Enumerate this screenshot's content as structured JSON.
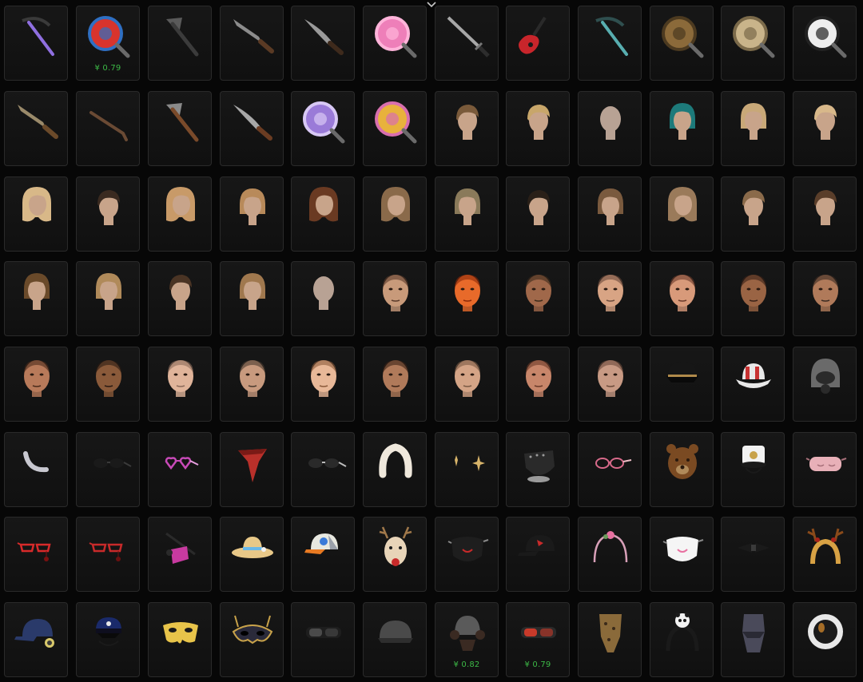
{
  "items": [
    {
      "icon": "purple-sickle-icon",
      "kind": "sickle",
      "c1": "#8f6fe0",
      "c2": "#3a3a3a",
      "price": ""
    },
    {
      "icon": "target-pan-icon",
      "kind": "pan",
      "c1": "#d8342d",
      "c2": "#2f6fc2",
      "price": "¥ 0.79"
    },
    {
      "icon": "hatchet-icon",
      "kind": "axe",
      "c1": "#5a5a5a",
      "c2": "#3b3b3b",
      "price": ""
    },
    {
      "icon": "cleaver-machete-icon",
      "kind": "machete",
      "c1": "#8c8c8c",
      "c2": "#5a3a24",
      "price": ""
    },
    {
      "icon": "kukri-knife-icon",
      "kind": "blade",
      "c1": "#9a9a9a",
      "c2": "#3e2a1c",
      "price": ""
    },
    {
      "icon": "pink-floral-pan-icon",
      "kind": "pan",
      "c1": "#ee7fb9",
      "c2": "#ffb4da",
      "price": ""
    },
    {
      "icon": "katana-icon",
      "kind": "sword",
      "c1": "#a7a7a7",
      "c2": "#2d2d2d",
      "price": ""
    },
    {
      "icon": "electric-guitar-icon",
      "kind": "guitar",
      "c1": "#c8252b",
      "c2": "#1a1a1a",
      "price": ""
    },
    {
      "icon": "teal-sickle-icon",
      "kind": "sickle",
      "c1": "#58aeb0",
      "c2": "#2f4f4f",
      "price": ""
    },
    {
      "icon": "ornate-gold-pan-icon",
      "kind": "pan",
      "c1": "#8b6a3a",
      "c2": "#4c3a20",
      "price": ""
    },
    {
      "icon": "silver-engraved-pan-icon",
      "kind": "pan",
      "c1": "#c9b48a",
      "c2": "#7b6a4a",
      "price": ""
    },
    {
      "icon": "black-white-pan-icon",
      "kind": "pan",
      "c1": "#eeeeee",
      "c2": "#222222",
      "price": ""
    },
    {
      "icon": "machete-icon",
      "kind": "machete",
      "c1": "#9a8a6a",
      "c2": "#6b4a2a",
      "price": ""
    },
    {
      "icon": "crowbar-icon",
      "kind": "crowbar",
      "c1": "#6a4a34",
      "c2": "#3a2a20",
      "price": ""
    },
    {
      "icon": "wood-axe-icon",
      "kind": "axe",
      "c1": "#8a8a8a",
      "c2": "#7a4a2a",
      "price": ""
    },
    {
      "icon": "curved-machete-icon",
      "kind": "blade",
      "c1": "#a8a8a8",
      "c2": "#6b3c22",
      "price": ""
    },
    {
      "icon": "purple-pan-icon",
      "kind": "pan",
      "c1": "#9a7ad8",
      "c2": "#d8c8f5",
      "price": ""
    },
    {
      "icon": "candy-swirl-pan-icon",
      "kind": "pan",
      "c1": "#e8b23c",
      "c2": "#d86fae",
      "price": ""
    },
    {
      "icon": "hair-short-brown-icon",
      "kind": "hairmale",
      "c1": "#7a5a3a",
      "c2": "#c8a48a",
      "price": ""
    },
    {
      "icon": "hair-short-blonde-icon",
      "kind": "hairmale",
      "c1": "#c8a66a",
      "c2": "#c8a48a",
      "price": ""
    },
    {
      "icon": "hair-shaved-icon",
      "kind": "head",
      "c1": "#b8a294",
      "c2": "#b8a294",
      "price": ""
    },
    {
      "icon": "hair-teal-bob-icon",
      "kind": "hairbob",
      "c1": "#1d7a7a",
      "c2": "#c8a48a",
      "price": ""
    },
    {
      "icon": "hair-blonde-bob-icon",
      "kind": "hairbob",
      "c1": "#c8a878",
      "c2": "#c8a48a",
      "price": ""
    },
    {
      "icon": "hair-blonde-short-icon",
      "kind": "hairmale",
      "c1": "#d8b88a",
      "c2": "#c8a48a",
      "price": ""
    },
    {
      "icon": "hair-blonde-long-icon",
      "kind": "hairlong",
      "c1": "#d8b888",
      "c2": "#c8a48a",
      "price": ""
    },
    {
      "icon": "hair-dark-undercut-icon",
      "kind": "hairmale",
      "c1": "#3a2a20",
      "c2": "#c8a48a",
      "price": ""
    },
    {
      "icon": "hair-blonde-shoulder-icon",
      "kind": "hairlong",
      "c1": "#c89a68",
      "c2": "#c8a48a",
      "price": ""
    },
    {
      "icon": "hair-braided-bun-icon",
      "kind": "hairbob",
      "c1": "#b88a5a",
      "c2": "#c8a48a",
      "price": ""
    },
    {
      "icon": "hair-brown-braids-icon",
      "kind": "hairlong",
      "c1": "#6a3a22",
      "c2": "#c8a48a",
      "price": ""
    },
    {
      "icon": "hair-wavy-brown-icon",
      "kind": "hairlong",
      "c1": "#8a6a4a",
      "c2": "#c8a48a",
      "price": ""
    },
    {
      "icon": "hair-bob-ash-icon",
      "kind": "hairbob",
      "c1": "#8a7a5a",
      "c2": "#c8a48a",
      "price": ""
    },
    {
      "icon": "hair-fade-dark-icon",
      "kind": "hairmale",
      "c1": "#2a2018",
      "c2": "#c8a48a",
      "price": ""
    },
    {
      "icon": "hair-messy-brown-icon",
      "kind": "hairbob",
      "c1": "#7a5a3e",
      "c2": "#c8a48a",
      "price": ""
    },
    {
      "icon": "hair-braided-light-icon",
      "kind": "hairlong",
      "c1": "#9a7a5a",
      "c2": "#c8a48a",
      "price": ""
    },
    {
      "icon": "hair-side-cut-icon",
      "kind": "hairmale",
      "c1": "#8a6a4a",
      "c2": "#c8a48a",
      "price": ""
    },
    {
      "icon": "hair-cornrow-icon",
      "kind": "hairmale",
      "c1": "#5a3e2a",
      "c2": "#c8a48a",
      "price": ""
    },
    {
      "icon": "hair-brown-fringe-icon",
      "kind": "hairbob",
      "c1": "#6a4a2a",
      "c2": "#c8a48a",
      "price": ""
    },
    {
      "icon": "hair-light-bob-icon",
      "kind": "hairbob",
      "c1": "#b08a5a",
      "c2": "#c8a48a",
      "price": ""
    },
    {
      "icon": "hair-quiff-icon",
      "kind": "hairmale",
      "c1": "#4a3424",
      "c2": "#c8a48a",
      "price": ""
    },
    {
      "icon": "hair-swept-bob-icon",
      "kind": "hairbob",
      "c1": "#a0784e",
      "c2": "#c8a48a",
      "price": ""
    },
    {
      "icon": "face-bald-profile-icon",
      "kind": "head",
      "c1": "#b8a294",
      "c2": "#b8a294",
      "price": ""
    },
    {
      "icon": "face-male-1-icon",
      "kind": "face",
      "c1": "#c89a7a",
      "c2": "#5a3a2a",
      "price": ""
    },
    {
      "icon": "face-male-orange-icon",
      "kind": "face",
      "c1": "#e86a2a",
      "c2": "#8a2a0a",
      "price": ""
    },
    {
      "icon": "face-male-2-icon",
      "kind": "face",
      "c1": "#a0684a",
      "c2": "#3a2a1a",
      "price": ""
    },
    {
      "icon": "face-male-3-icon",
      "kind": "face",
      "c1": "#d8a484",
      "c2": "#6a4a3a",
      "price": ""
    },
    {
      "icon": "face-male-4-icon",
      "kind": "face",
      "c1": "#d89a7a",
      "c2": "#6a3a2a",
      "price": ""
    },
    {
      "icon": "face-male-5-icon",
      "kind": "face",
      "c1": "#9a6444",
      "c2": "#3a2218",
      "price": ""
    },
    {
      "icon": "face-female-1-icon",
      "kind": "face",
      "c1": "#b07a5a",
      "c2": "#3a2a22",
      "price": ""
    },
    {
      "icon": "face-male-6-icon",
      "kind": "face",
      "c1": "#b87a5a",
      "c2": "#4a2a1a",
      "price": ""
    },
    {
      "icon": "face-male-7-icon",
      "kind": "face",
      "c1": "#8a5a3a",
      "c2": "#2a1a12",
      "price": ""
    },
    {
      "icon": "face-female-2-icon",
      "kind": "face",
      "c1": "#e0b49a",
      "c2": "#8a6a5a",
      "price": ""
    },
    {
      "icon": "face-female-3-icon",
      "kind": "face",
      "c1": "#c89a7e",
      "c2": "#4a3a2e",
      "price": ""
    },
    {
      "icon": "face-female-4-icon",
      "kind": "face",
      "c1": "#e8b898",
      "c2": "#8a5a3a",
      "price": ""
    },
    {
      "icon": "face-female-5-icon",
      "kind": "face",
      "c1": "#b07a5a",
      "c2": "#3a2216",
      "price": ""
    },
    {
      "icon": "face-female-6-icon",
      "kind": "face",
      "c1": "#d4a486",
      "c2": "#7a5a44",
      "price": ""
    },
    {
      "icon": "face-female-7-icon",
      "kind": "face",
      "c1": "#c8866a",
      "c2": "#6a3a28",
      "price": ""
    },
    {
      "icon": "face-female-8-icon",
      "kind": "face",
      "c1": "#c89a84",
      "c2": "#6a4a3a",
      "price": ""
    },
    {
      "icon": "officer-cap-icon",
      "kind": "cap",
      "c1": "#161616",
      "c2": "#b08a4a",
      "price": ""
    },
    {
      "icon": "striped-bucket-hat-icon",
      "kind": "bucket",
      "c1": "#e8e8e8",
      "c2": "#c83232",
      "price": ""
    },
    {
      "icon": "gas-mask-helmet-icon",
      "kind": "helmet",
      "c1": "#6a6a6a",
      "c2": "#2a2a2a",
      "price": ""
    },
    {
      "icon": "ring-accessory-icon",
      "kind": "ring",
      "c1": "#c8c8d0",
      "c2": "#2a2a2a",
      "price": ""
    },
    {
      "icon": "black-sunglasses-icon",
      "kind": "glasses",
      "c1": "#1a1a1a",
      "c2": "#3a3a3a",
      "price": ""
    },
    {
      "icon": "heart-glasses-icon",
      "kind": "heartglasses",
      "c1": "#c84ab8",
      "c2": "#e8a0e0",
      "price": ""
    },
    {
      "icon": "red-bandana-icon",
      "kind": "bandana",
      "c1": "#b8302a",
      "c2": "#7a1a16",
      "price": ""
    },
    {
      "icon": "aviator-glasses-icon",
      "kind": "glasses",
      "c1": "#2a2a2a",
      "c2": "#bcbcbc",
      "price": ""
    },
    {
      "icon": "fur-headband-icon",
      "kind": "fur",
      "c1": "#efe8dc",
      "c2": "#bab0a2",
      "price": ""
    },
    {
      "icon": "star-earrings-icon",
      "kind": "earrings",
      "c1": "#d8b46a",
      "c2": "#8a6a3a",
      "price": ""
    },
    {
      "icon": "spiked-mask-icon",
      "kind": "mask",
      "c1": "#2a2a2a",
      "c2": "#9a9a9a",
      "price": ""
    },
    {
      "icon": "pink-round-glasses-icon",
      "kind": "glasses2",
      "c1": "#d86a8a",
      "c2": "#f0c0c8",
      "price": ""
    },
    {
      "icon": "bear-head-icon",
      "kind": "bear",
      "c1": "#7a4a22",
      "c2": "#2a1a0e",
      "price": ""
    },
    {
      "icon": "sailor-hat-icon",
      "kind": "sailor",
      "c1": "#f2f2f2",
      "c2": "#c8a24a",
      "price": ""
    },
    {
      "icon": "pink-sleep-mask-icon",
      "kind": "sleepmask",
      "c1": "#e8b0b8",
      "c2": "#a8707a",
      "price": ""
    },
    {
      "icon": "red-cat-eye-glasses-icon",
      "kind": "catglasses",
      "c1": "#d82a2a",
      "c2": "#7a1010",
      "price": ""
    },
    {
      "icon": "red-cat-eye-glasses-2-icon",
      "kind": "catglasses",
      "c1": "#c82a2a",
      "c2": "#6a1010",
      "price": ""
    },
    {
      "icon": "pink-eyepatch-icon",
      "kind": "eyepatch",
      "c1": "#c83aa0",
      "c2": "#2a2a2a",
      "price": ""
    },
    {
      "icon": "straw-hat-icon",
      "kind": "strawhat",
      "c1": "#e8c888",
      "c2": "#6ab8e8",
      "price": ""
    },
    {
      "icon": "baseball-cap-icon",
      "kind": "baseball",
      "c1": "#e8e8e0",
      "c2": "#e87a22",
      "price": ""
    },
    {
      "icon": "reindeer-mask-icon",
      "kind": "reindeer",
      "c1": "#e8d4b8",
      "c2": "#c82a2a",
      "price": ""
    },
    {
      "icon": "black-face-mask-icon",
      "kind": "facemask",
      "c1": "#1e1e1e",
      "c2": "#c82a2a",
      "price": ""
    },
    {
      "icon": "black-cap-icon",
      "kind": "blackcap",
      "c1": "#1a1a1a",
      "c2": "#c82a2a",
      "price": ""
    },
    {
      "icon": "rose-headband-icon",
      "kind": "headband",
      "c1": "#e870a0",
      "c2": "#d8a0b8",
      "price": ""
    },
    {
      "icon": "kawaii-mask-icon",
      "kind": "facemask",
      "c1": "#f5f5f5",
      "c2": "#e870a0",
      "price": ""
    },
    {
      "icon": "black-bow-tie-icon",
      "kind": "bowtie",
      "c1": "#1a1a1a",
      "c2": "#3a3a3a",
      "price": ""
    },
    {
      "icon": "antler-headband-icon",
      "kind": "antler",
      "c1": "#d8a244",
      "c2": "#a8221a",
      "price": ""
    },
    {
      "icon": "headset-cap-icon",
      "kind": "headsetcap",
      "c1": "#2a3a6a",
      "c2": "#d8c86a",
      "price": ""
    },
    {
      "icon": "police-cap-icon",
      "kind": "policecap",
      "c1": "#1a2a6a",
      "c2": "#e8e8e8",
      "price": ""
    },
    {
      "icon": "gold-half-mask-icon",
      "kind": "halfmask",
      "c1": "#e8c44a",
      "c2": "#a8841a",
      "price": ""
    },
    {
      "icon": "masquerade-mask-icon",
      "kind": "masquerade",
      "c1": "#c8a24a",
      "c2": "#2a2a3a",
      "price": ""
    },
    {
      "icon": "tactical-goggles-icon",
      "kind": "goggles",
      "c1": "#1e1e1e",
      "c2": "#4a4a4a",
      "price": ""
    },
    {
      "icon": "grey-cap-icon",
      "kind": "greycap",
      "c1": "#4a4a4a",
      "c2": "#2e2e2e",
      "price": ""
    },
    {
      "icon": "pilot-helmet-icon",
      "kind": "pilot",
      "c1": "#5a5a5a",
      "c2": "#3a2a22",
      "price": "¥ 0.82"
    },
    {
      "icon": "visor-goggles-icon",
      "kind": "goggles",
      "c1": "#2a2a2a",
      "c2": "#c83a2a",
      "price": "¥ 0.79"
    },
    {
      "icon": "leopard-scarf-icon",
      "kind": "scarf",
      "c1": "#8a6a3a",
      "c2": "#3a2a1a",
      "price": ""
    },
    {
      "icon": "panda-headband-icon",
      "kind": "panda",
      "c1": "#f2f2f2",
      "c2": "#1a1a1a",
      "price": ""
    },
    {
      "icon": "grey-neck-gaiter-icon",
      "kind": "gaiter",
      "c1": "#4a4a5a",
      "c2": "#2a2a34",
      "price": ""
    },
    {
      "icon": "astronaut-helmet-icon",
      "kind": "astronaut",
      "c1": "#e8e8e8",
      "c2": "#c8822a",
      "price": ""
    }
  ]
}
